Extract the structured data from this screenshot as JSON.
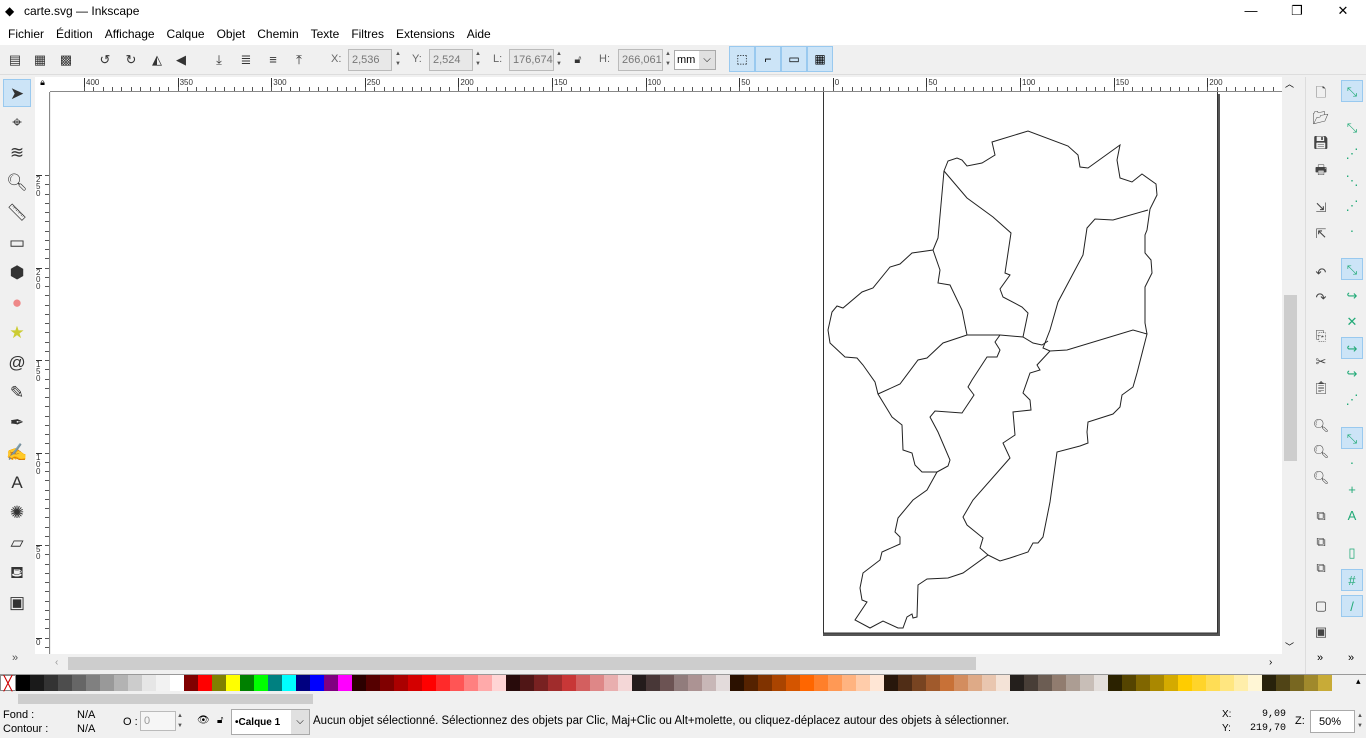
{
  "window": {
    "title": "carte.svg — Inkscape",
    "minimize": "—",
    "maximize": "❐",
    "close": "✕"
  },
  "menu": [
    "Fichier",
    "Édition",
    "Affichage",
    "Calque",
    "Objet",
    "Chemin",
    "Texte",
    "Filtres",
    "Extensions",
    "Aide"
  ],
  "toolbar": {
    "x_label": "X:",
    "x_value": "2,536",
    "y_label": "Y:",
    "y_value": "2,524",
    "w_label": "L:",
    "w_value": "176,674",
    "h_label": "H:",
    "h_value": "266,061",
    "unit": "mm"
  },
  "rulers": {
    "top": [
      "400",
      "350",
      "300",
      "250",
      "200",
      "150",
      "100",
      "50",
      "0",
      "50",
      "100",
      "150",
      "200"
    ],
    "left": [
      "250",
      "200",
      "150",
      "100",
      "50",
      "0"
    ]
  },
  "palette": [
    "#000000",
    "#1a1a1a",
    "#333333",
    "#4d4d4d",
    "#666666",
    "#808080",
    "#999999",
    "#b3b3b3",
    "#cccccc",
    "#e6e6e6",
    "#f2f2f2",
    "#ffffff",
    "#800000",
    "#ff0000",
    "#808000",
    "#ffff00",
    "#008000",
    "#00ff00",
    "#008080",
    "#00ffff",
    "#000080",
    "#0000ff",
    "#800080",
    "#ff00ff",
    "#2b0000",
    "#550000",
    "#800000",
    "#aa0000",
    "#d40000",
    "#ff0000",
    "#ff2a2a",
    "#ff5555",
    "#ff8080",
    "#ffaaaa",
    "#ffd5d5",
    "#280b0b",
    "#501616",
    "#782121",
    "#a02c2c",
    "#c83737",
    "#d35f5f",
    "#de8787",
    "#e9afaf",
    "#f4d7d7",
    "#241c1c",
    "#483737",
    "#6c5353",
    "#917c7c",
    "#ac9393",
    "#c8b7b7",
    "#e3dbdb",
    "#2b1100",
    "#552200",
    "#803300",
    "#aa4400",
    "#d45500",
    "#ff6600",
    "#ff7f2a",
    "#ff9955",
    "#ffb380",
    "#ffccaa",
    "#ffe6d5",
    "#28170b",
    "#502d16",
    "#784421",
    "#a05a2c",
    "#c87137",
    "#d38d5f",
    "#deaa87",
    "#e9c6af",
    "#f4e3d7",
    "#241f1c",
    "#483e37",
    "#6c5d53",
    "#917c6f",
    "#ac9d93",
    "#c8beb7",
    "#e3dedb",
    "#2b2200",
    "#554400",
    "#806600",
    "#aa8800",
    "#d4aa00",
    "#ffcc00",
    "#ffd42a",
    "#ffdd55",
    "#ffe680",
    "#ffeeaa",
    "#fff6d5",
    "#28220b",
    "#504416",
    "#786721",
    "#a0892c",
    "#c8ab37"
  ],
  "status": {
    "fill_label": "Fond :",
    "fill_value": "N/A",
    "stroke_label": "Contour :",
    "stroke_value": "N/A",
    "opacity_label": "O :",
    "opacity_value": "0",
    "layer": "•Calque 1",
    "message": "Aucun objet sélectionné. Sélectionnez des objets par Clic, Maj+Clic ou Alt+molette, ou cliquez-déplacez autour des objets à sélectionner.",
    "x_label": "X:",
    "x_value": "9,09",
    "y_label": "Y:",
    "y_value": "219,70",
    "zoom_label": "Z:",
    "zoom_value": "50%"
  },
  "icons": {
    "left_tools": [
      "selector-arrow-icon",
      "node-tool-icon",
      "tweak-tool-icon",
      "zoom-tool-icon",
      "measure-tool-icon",
      "rectangle-tool-icon",
      "3d-box-tool-icon",
      "ellipse-tool-icon",
      "star-tool-icon",
      "spiral-tool-icon",
      "pencil-tool-icon",
      "pen-tool-icon",
      "calligraphy-tool-icon",
      "text-tool-icon",
      "spray-tool-icon",
      "eraser-tool-icon",
      "paint-bucket-icon",
      "gradient-tool-icon"
    ]
  }
}
